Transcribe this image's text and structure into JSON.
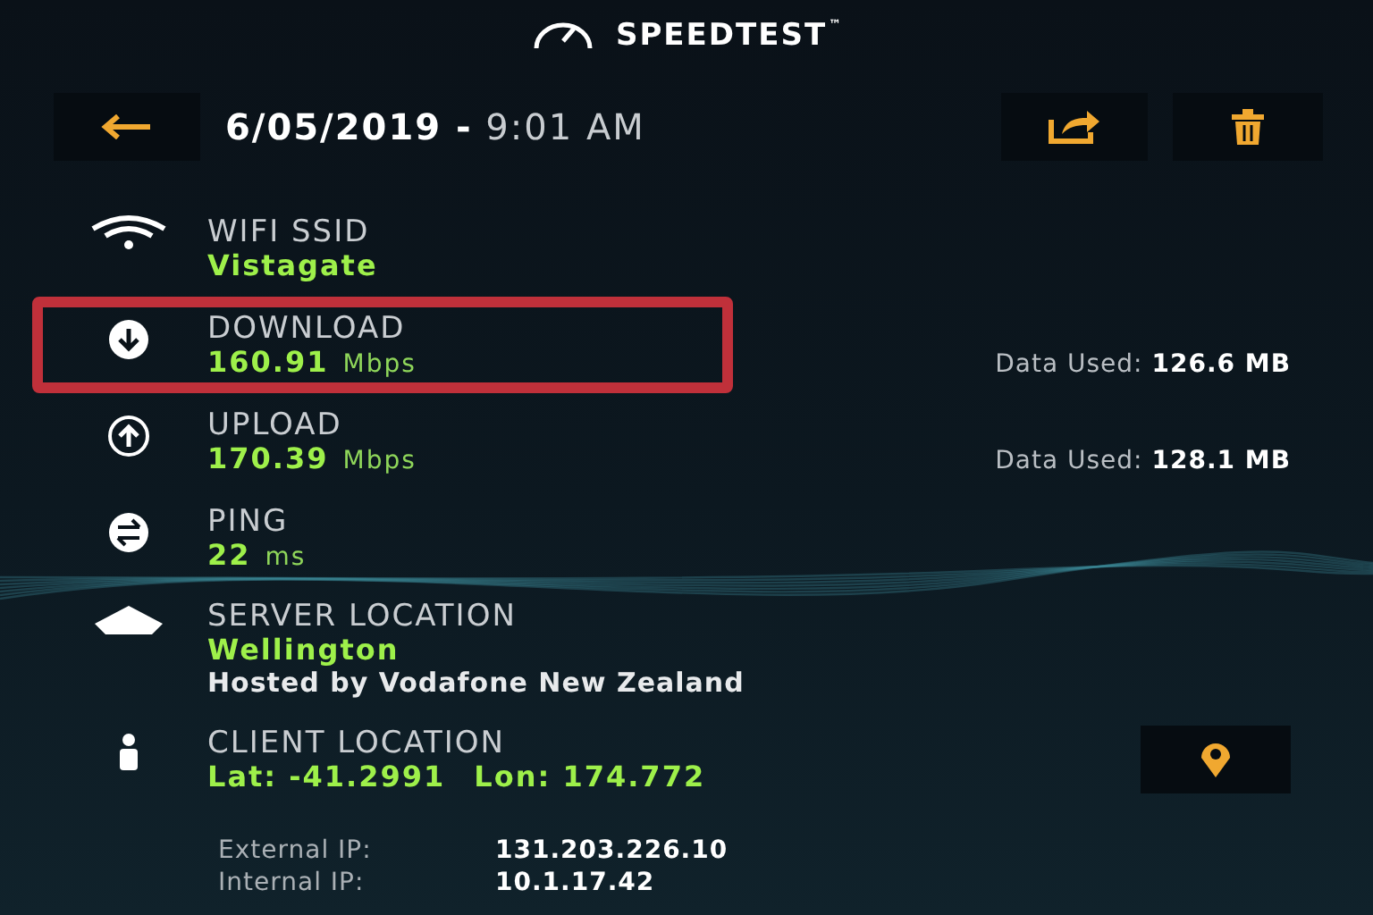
{
  "header": {
    "title": "SPEEDTEST",
    "trademark": "™"
  },
  "result": {
    "date": "6/05/2019",
    "separator": "-",
    "time": "9:01 AM"
  },
  "items": [
    {
      "kind": "wifi",
      "label": "WIFI SSID",
      "value": "Vistagate"
    },
    {
      "kind": "download",
      "label": "DOWNLOAD",
      "value": "160.91",
      "unit": "Mbps",
      "data_used_label": "Data Used:",
      "data_used": "126.6 MB",
      "highlighted": true
    },
    {
      "kind": "upload",
      "label": "UPLOAD",
      "value": "170.39",
      "unit": "Mbps",
      "data_used_label": "Data Used:",
      "data_used": "128.1 MB",
      "highlighted": false
    },
    {
      "kind": "ping",
      "label": "PING",
      "value": "22",
      "unit": "ms"
    },
    {
      "kind": "server",
      "label": "SERVER LOCATION",
      "value": "Wellington",
      "detail": "Hosted by Vodafone New Zealand"
    },
    {
      "kind": "client",
      "label": "CLIENT LOCATION",
      "coordinates": [
        {
          "label": "Lat:",
          "value": "-41.2991"
        },
        {
          "label": "Lon:",
          "value": "174.772"
        }
      ]
    }
  ],
  "ip": [
    {
      "label": "External IP:",
      "value": "131.203.226.10"
    },
    {
      "label": "Internal IP:",
      "value": "10.1.17.42"
    }
  ]
}
